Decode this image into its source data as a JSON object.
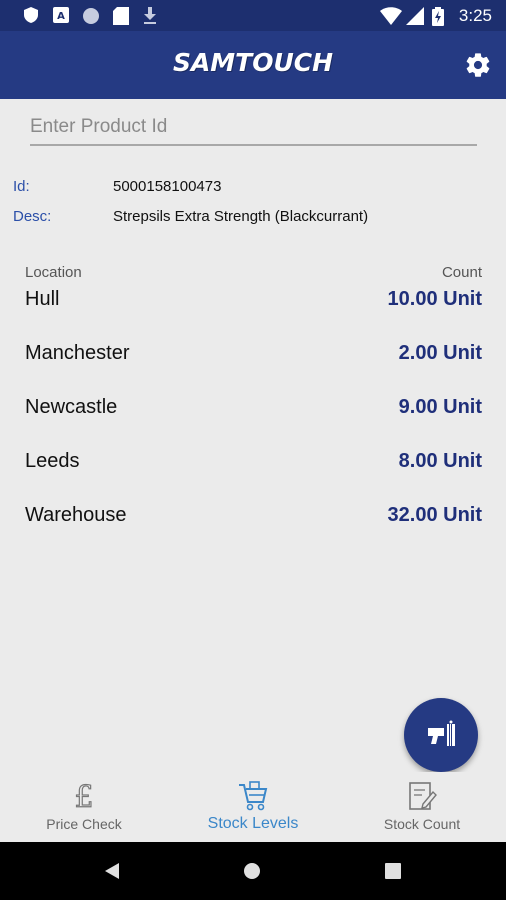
{
  "status_bar": {
    "time": "3:25",
    "icons": [
      "shield-icon",
      "translate-icon",
      "circle-icon",
      "sd-card-icon",
      "download-icon",
      "wifi-icon",
      "signal-icon",
      "battery-charging-icon"
    ]
  },
  "app_bar": {
    "logo_text": "SAMTOUCH",
    "settings_icon": "gear-icon"
  },
  "search": {
    "placeholder": "Enter Product Id",
    "value": ""
  },
  "product": {
    "id_label": "Id:",
    "id_value": "5000158100473",
    "desc_label": "Desc:",
    "desc_value": "Strepsils Extra Strength (Blackcurrant)"
  },
  "stock_table": {
    "location_header": "Location",
    "count_header": "Count",
    "rows": [
      {
        "location": "Hull",
        "count": "10.00 Unit"
      },
      {
        "location": "Manchester",
        "count": "2.00 Unit"
      },
      {
        "location": "Newcastle",
        "count": "9.00 Unit"
      },
      {
        "location": "Leeds",
        "count": "8.00 Unit"
      },
      {
        "location": "Warehouse",
        "count": "32.00 Unit"
      }
    ]
  },
  "fab": {
    "icon": "barcode-scanner-icon"
  },
  "bottom_nav": {
    "items": [
      {
        "label": "Price Check",
        "icon": "pound-icon",
        "active": false
      },
      {
        "label": "Stock Levels",
        "icon": "cart-icon",
        "active": true
      },
      {
        "label": "Stock Count",
        "icon": "clipboard-edit-icon",
        "active": false
      }
    ]
  },
  "colors": {
    "primary": "#253a83",
    "status_bar": "#1d2f6f",
    "active_tab": "#3b87c9",
    "count_text": "#1f2f7a",
    "label_blue": "#2b4fa8",
    "background": "#ebebeb"
  }
}
